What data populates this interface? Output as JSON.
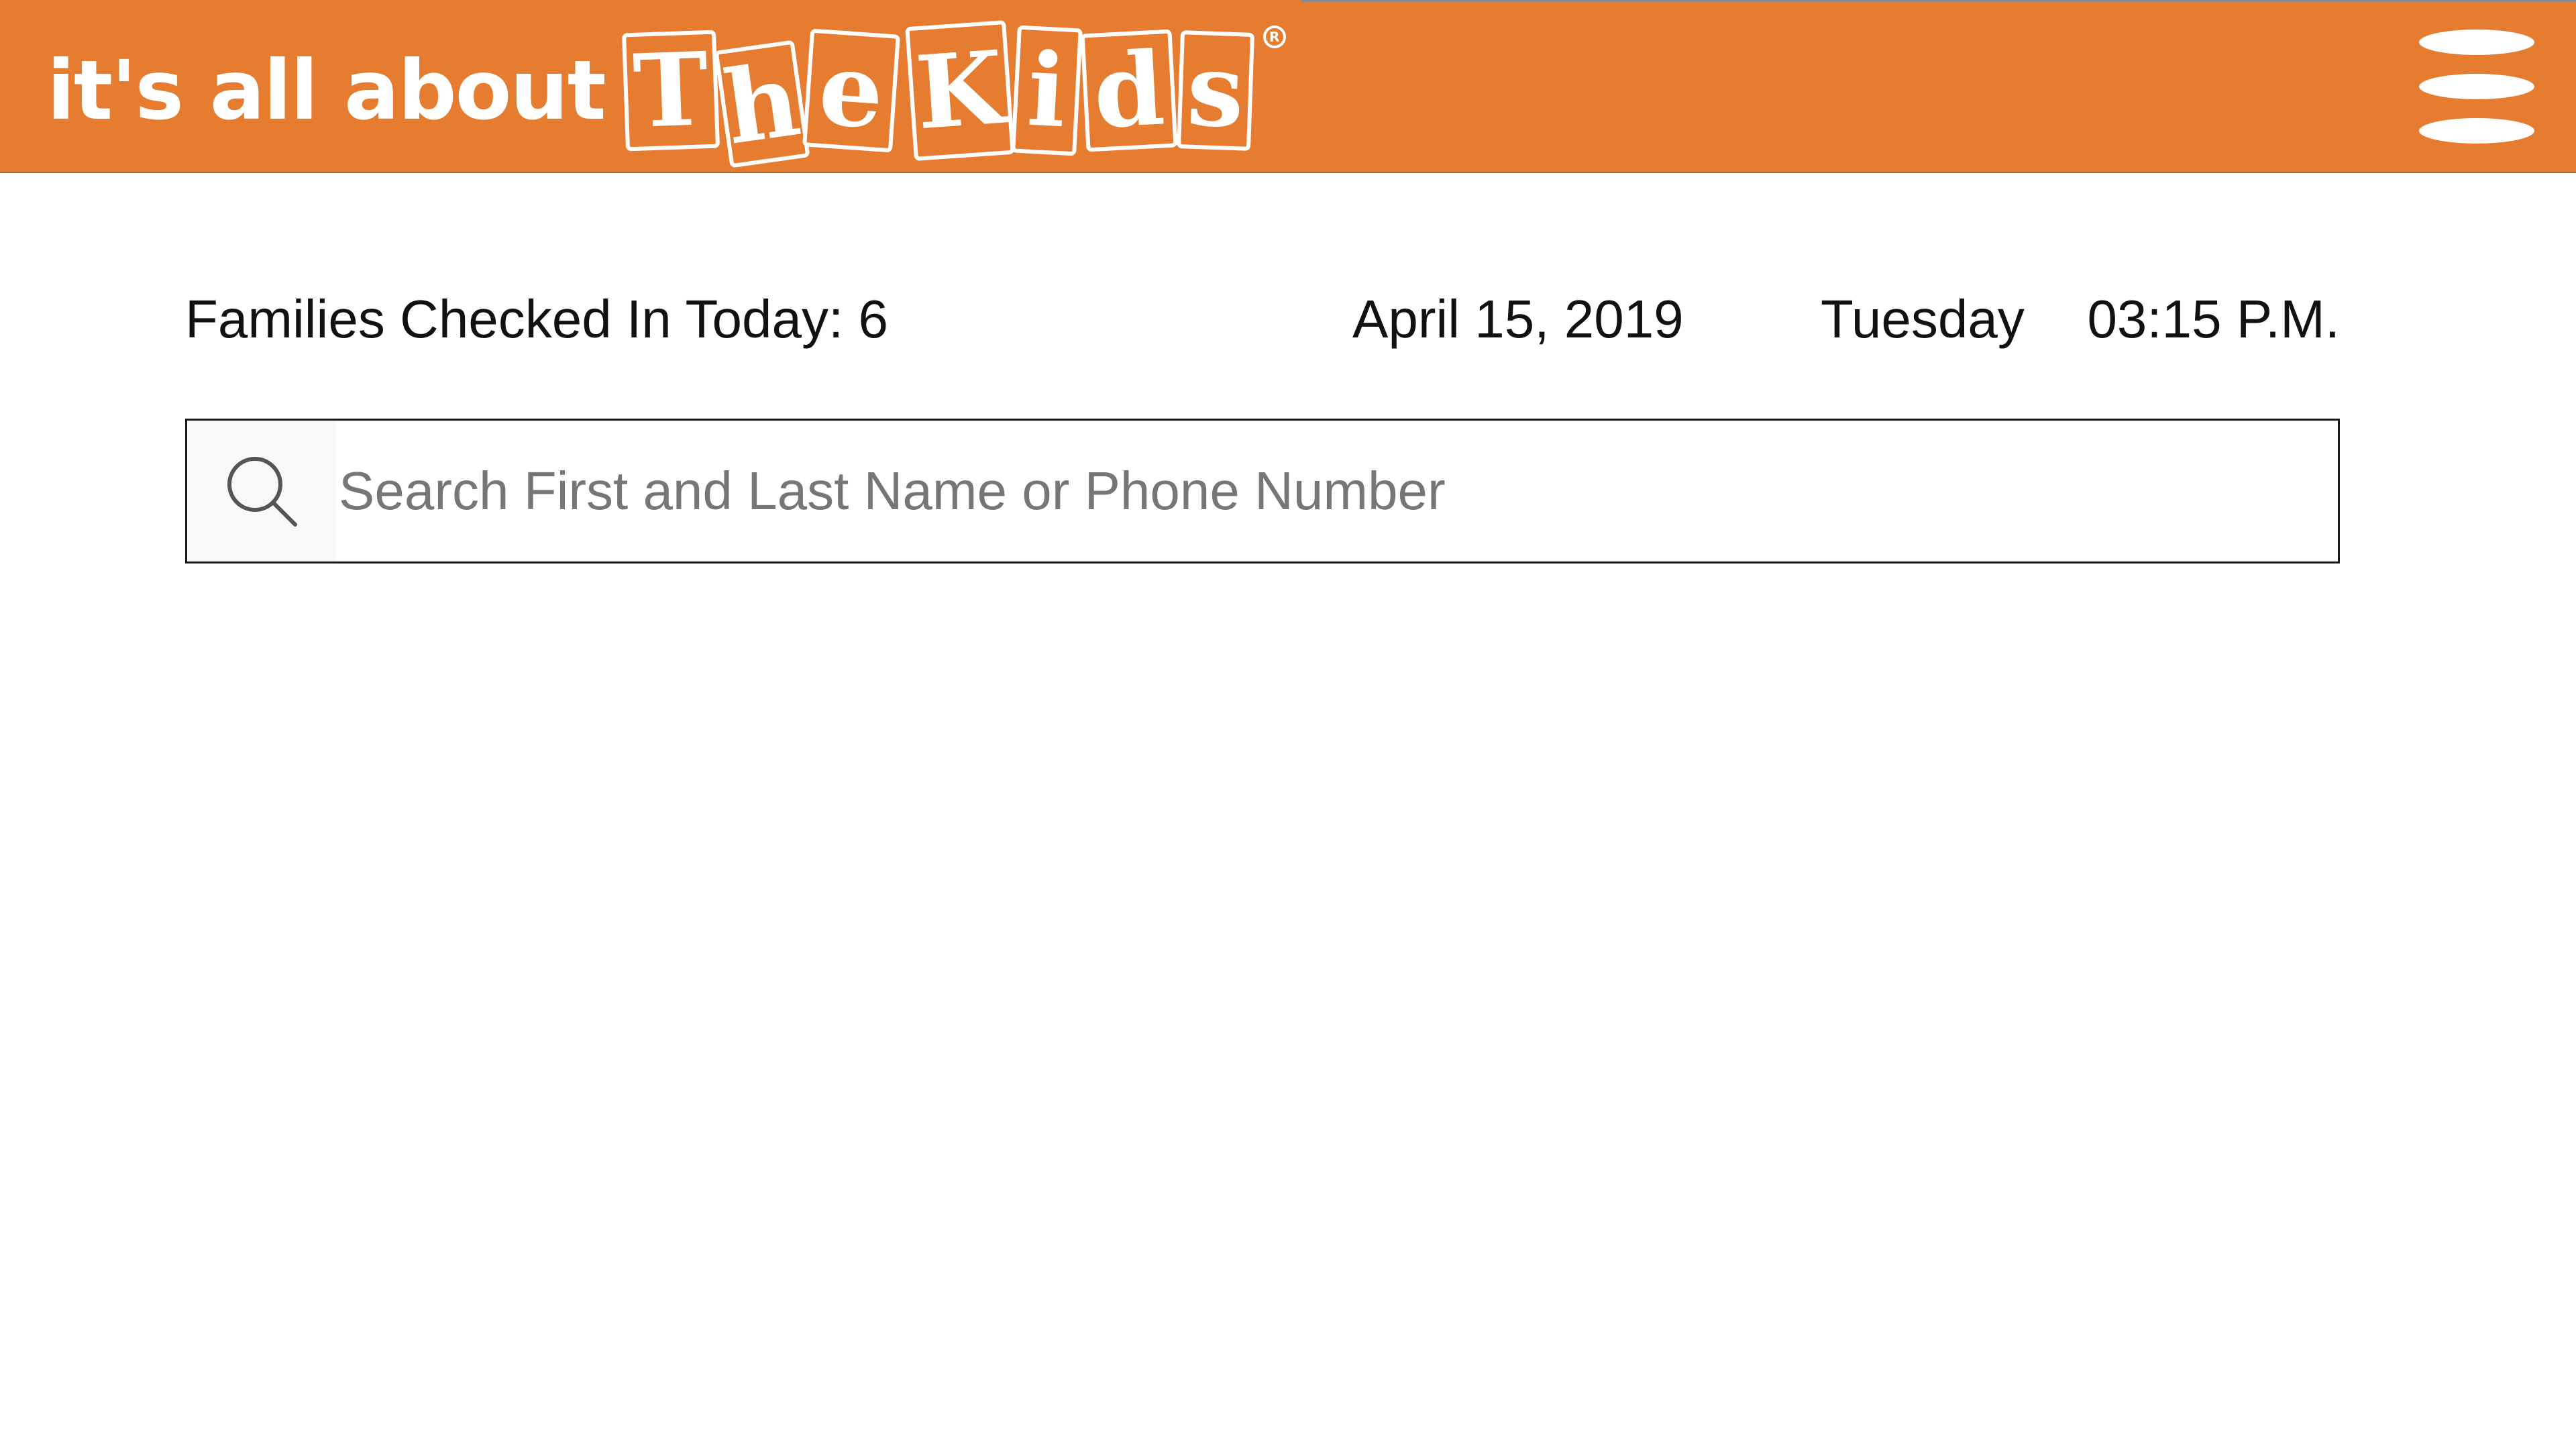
{
  "header": {
    "brand_prefix": "it's all about",
    "brand_tiles": [
      "T",
      "h",
      "e",
      "K",
      "i",
      "d",
      "s"
    ],
    "registered_mark": "R",
    "menu_icon": "hamburger-menu-icon",
    "accent_color": "#e67c2f"
  },
  "status": {
    "families_checked_in": "Families Checked In Today: 6",
    "date": "April 15, 2019",
    "day": "Tuesday",
    "time": "03:15 P.M."
  },
  "search": {
    "icon": "search-icon",
    "placeholder": "Search First and Last Name or Phone Number",
    "value": ""
  }
}
